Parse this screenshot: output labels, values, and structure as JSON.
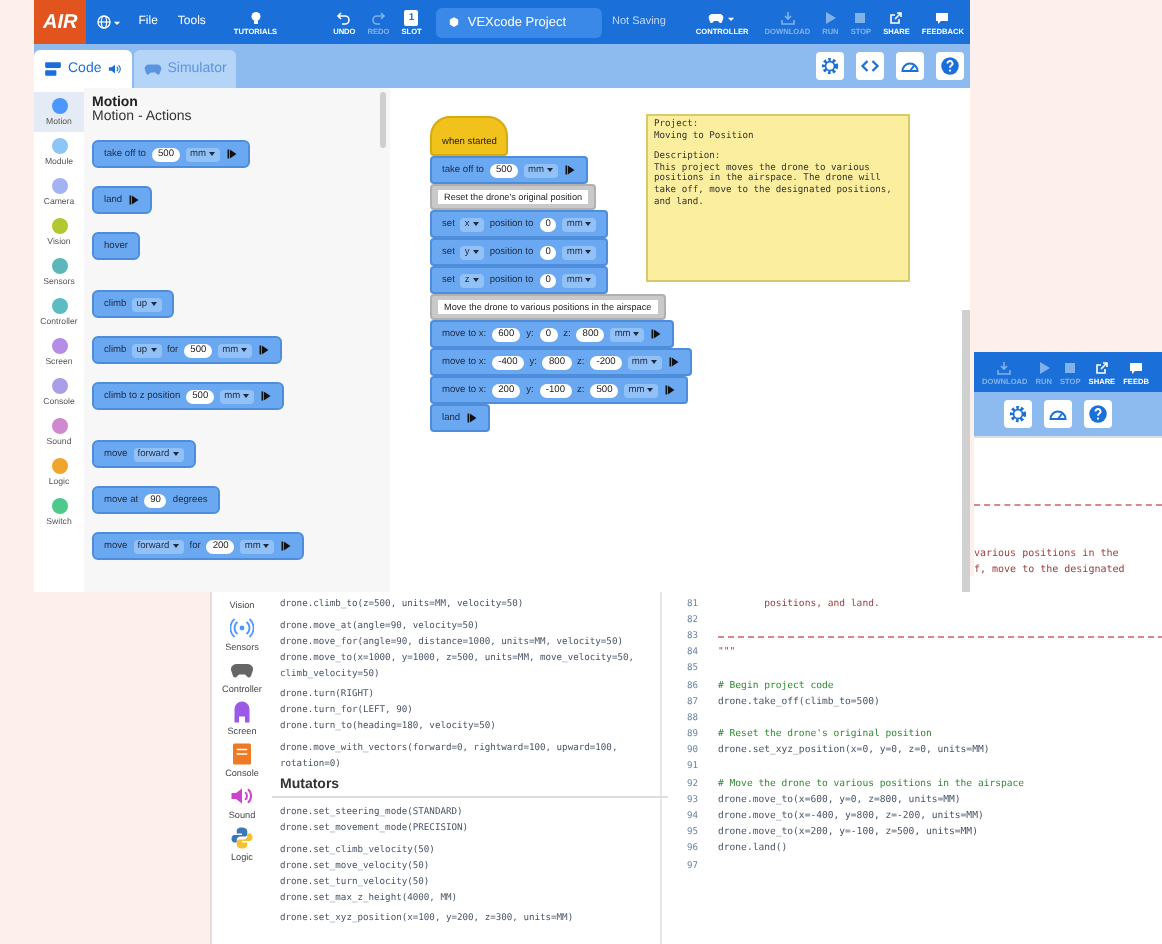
{
  "main_window": {
    "toolbar": {
      "logo": "AIR",
      "menus": [
        "File",
        "Tools"
      ],
      "tutorials": "TUTORIALS",
      "undo": {
        "label": "UNDO",
        "disabled": false
      },
      "redo": {
        "label": "REDO",
        "disabled": true
      },
      "slot": {
        "label": "SLOT",
        "number": "1"
      },
      "project_name": "VEXcode Project",
      "save_status": "Not Saving",
      "controller": "CONTROLLER",
      "actions": [
        {
          "kind": "download",
          "label": "DOWNLOAD",
          "disabled": true
        },
        {
          "kind": "run",
          "label": "RUN",
          "disabled": true
        },
        {
          "kind": "stop",
          "label": "STOP",
          "disabled": true
        },
        {
          "kind": "share",
          "label": "SHARE",
          "disabled": false
        },
        {
          "kind": "feedback",
          "label": "FEEDBACK",
          "disabled": false
        }
      ]
    },
    "tabs": [
      {
        "kind": "code",
        "label": "Code",
        "selected": true
      },
      {
        "kind": "simulator",
        "label": "Simulator",
        "selected": false
      }
    ],
    "tool_buttons": [
      {
        "kind": "settings"
      },
      {
        "kind": "code"
      },
      {
        "kind": "dashboard"
      },
      {
        "kind": "help"
      }
    ],
    "categories": [
      {
        "label": "Motion",
        "color": "#4c97ff",
        "selected": true
      },
      {
        "label": "Module",
        "color": "#8ec5f7",
        "selected": false
      },
      {
        "label": "Camera",
        "color": "#a3b3f2",
        "selected": false
      },
      {
        "label": "Vision",
        "color": "#b3c72e",
        "selected": false
      },
      {
        "label": "Sensors",
        "color": "#5cb8b8",
        "selected": false
      },
      {
        "label": "Controller",
        "color": "#5bbcc4",
        "selected": false
      },
      {
        "label": "Screen",
        "color": "#b58ce8",
        "selected": false
      },
      {
        "label": "Console",
        "color": "#a99fe9",
        "selected": false
      },
      {
        "label": "Sound",
        "color": "#cf89cf",
        "selected": false
      },
      {
        "label": "Logic",
        "color": "#f0a62c",
        "selected": false
      },
      {
        "label": "Switch",
        "color": "#4ec98c",
        "selected": false
      }
    ],
    "palette": {
      "title": "Motion",
      "subtitle": "Motion - Actions",
      "groups": [
        [
          {
            "parts": [
              {
                "kind": "text",
                "text": "take off to"
              },
              {
                "kind": "num",
                "text": "500"
              },
              {
                "kind": "drop",
                "text": "mm"
              },
              {
                "kind": "run"
              }
            ]
          },
          {
            "parts": [
              {
                "kind": "text",
                "text": "land"
              },
              {
                "kind": "run"
              }
            ]
          },
          {
            "parts": [
              {
                "kind": "text",
                "text": "hover"
              }
            ]
          }
        ],
        [
          {
            "parts": [
              {
                "kind": "text",
                "text": "climb"
              },
              {
                "kind": "drop",
                "text": "up"
              }
            ]
          },
          {
            "parts": [
              {
                "kind": "text",
                "text": "climb"
              },
              {
                "kind": "drop",
                "text": "up"
              },
              {
                "kind": "text",
                "text": "for"
              },
              {
                "kind": "num",
                "text": "500"
              },
              {
                "kind": "drop",
                "text": "mm"
              },
              {
                "kind": "run"
              }
            ]
          },
          {
            "parts": [
              {
                "kind": "text",
                "text": "climb to z position"
              },
              {
                "kind": "num",
                "text": "500"
              },
              {
                "kind": "drop",
                "text": "mm"
              },
              {
                "kind": "run"
              }
            ]
          }
        ],
        [
          {
            "parts": [
              {
                "kind": "text",
                "text": "move"
              },
              {
                "kind": "drop",
                "text": "forward"
              }
            ]
          },
          {
            "parts": [
              {
                "kind": "text",
                "text": "move at"
              },
              {
                "kind": "num",
                "text": "90"
              },
              {
                "kind": "text",
                "text": "degrees"
              }
            ]
          },
          {
            "parts": [
              {
                "kind": "text",
                "text": "move"
              },
              {
                "kind": "drop",
                "text": "forward"
              },
              {
                "kind": "text",
                "text": "for"
              },
              {
                "kind": "num",
                "text": "200"
              },
              {
                "kind": "drop",
                "text": "mm"
              },
              {
                "kind": "run"
              }
            ]
          }
        ]
      ]
    },
    "canvas": {
      "hat": "when started",
      "stack": [
        {
          "kind": "block",
          "parts": [
            {
              "kind": "text",
              "text": "take off to"
            },
            {
              "kind": "num",
              "text": "500"
            },
            {
              "kind": "drop",
              "text": "mm"
            },
            {
              "kind": "run"
            }
          ]
        },
        {
          "kind": "comment",
          "text": "Reset the drone's original position"
        },
        {
          "kind": "block",
          "parts": [
            {
              "kind": "text",
              "text": "set"
            },
            {
              "kind": "drop",
              "text": "x"
            },
            {
              "kind": "text",
              "text": "position to"
            },
            {
              "kind": "num",
              "text": "0"
            },
            {
              "kind": "drop",
              "text": "mm"
            }
          ]
        },
        {
          "kind": "block",
          "parts": [
            {
              "kind": "text",
              "text": "set"
            },
            {
              "kind": "drop",
              "text": "y"
            },
            {
              "kind": "text",
              "text": "position to"
            },
            {
              "kind": "num",
              "text": "0"
            },
            {
              "kind": "drop",
              "text": "mm"
            }
          ]
        },
        {
          "kind": "block",
          "parts": [
            {
              "kind": "text",
              "text": "set"
            },
            {
              "kind": "drop",
              "text": "z"
            },
            {
              "kind": "text",
              "text": "position to"
            },
            {
              "kind": "num",
              "text": "0"
            },
            {
              "kind": "drop",
              "text": "mm"
            }
          ]
        },
        {
          "kind": "comment",
          "text": "Move the drone to various positions in the airspace"
        },
        {
          "kind": "block",
          "parts": [
            {
              "kind": "text",
              "text": "move to x:"
            },
            {
              "kind": "num",
              "text": "600"
            },
            {
              "kind": "text",
              "text": "y:"
            },
            {
              "kind": "num",
              "text": "0"
            },
            {
              "kind": "text",
              "text": "z:"
            },
            {
              "kind": "num",
              "text": "800"
            },
            {
              "kind": "drop",
              "text": "mm"
            },
            {
              "kind": "run"
            }
          ]
        },
        {
          "kind": "block",
          "parts": [
            {
              "kind": "text",
              "text": "move to x:"
            },
            {
              "kind": "num",
              "text": "-400"
            },
            {
              "kind": "text",
              "text": "y:"
            },
            {
              "kind": "num",
              "text": "800"
            },
            {
              "kind": "text",
              "text": "z:"
            },
            {
              "kind": "num",
              "text": "-200"
            },
            {
              "kind": "drop",
              "text": "mm"
            },
            {
              "kind": "run"
            }
          ]
        },
        {
          "kind": "block",
          "parts": [
            {
              "kind": "text",
              "text": "move to x:"
            },
            {
              "kind": "num",
              "text": "200"
            },
            {
              "kind": "text",
              "text": "y:"
            },
            {
              "kind": "num",
              "text": "-100"
            },
            {
              "kind": "text",
              "text": "z:"
            },
            {
              "kind": "num",
              "text": "500"
            },
            {
              "kind": "drop",
              "text": "mm"
            },
            {
              "kind": "run"
            }
          ]
        },
        {
          "kind": "block",
          "parts": [
            {
              "kind": "text",
              "text": "land"
            },
            {
              "kind": "run"
            }
          ]
        }
      ],
      "note": {
        "paragraphs": [
          "Project:\nMoving to Position",
          "Description:\nThis project moves the drone to various\npositions in the airspace. The drone will\ntake off, move to the designated positions,\nand land."
        ]
      }
    }
  },
  "side_window": {
    "actions": [
      {
        "kind": "download",
        "label": "DOWNLOAD",
        "disabled": true
      },
      {
        "kind": "run",
        "label": "RUN",
        "disabled": true
      },
      {
        "kind": "stop",
        "label": "STOP",
        "disabled": true
      },
      {
        "kind": "share",
        "label": "SHARE",
        "disabled": false
      },
      {
        "kind": "feedback",
        "label": "FEEDB",
        "disabled": false
      }
    ],
    "tool_buttons": [
      {
        "kind": "settings"
      },
      {
        "kind": "dashboard"
      },
      {
        "kind": "help"
      }
    ],
    "lines": [
      {
        "kind": "rule"
      },
      {
        "kind": "doc",
        "text": "various positions in the"
      },
      {
        "kind": "doc",
        "text": "f, move to the designated"
      }
    ]
  },
  "bottom_window": {
    "categories": [
      {
        "kind": "vision",
        "label": "Vision"
      },
      {
        "kind": "sensors",
        "label": "Sensors"
      },
      {
        "kind": "controller",
        "label": "Controller"
      },
      {
        "kind": "screen",
        "label": "Screen"
      },
      {
        "kind": "console",
        "label": "Console"
      },
      {
        "kind": "sound",
        "label": "Sound"
      },
      {
        "kind": "logic",
        "label": "Logic"
      }
    ],
    "reference": [
      {
        "kind": "code",
        "lines": [
          "drone.climb_to(z=500, units=MM, velocity=50)"
        ]
      },
      {
        "kind": "code",
        "lines": [
          "drone.move_at(angle=90, velocity=50)",
          "drone.move_for(angle=90, distance=1000, units=MM, velocity=50)",
          "drone.move_to(x=1000, y=1000, z=500, units=MM, move_velocity=50,",
          "climb_velocity=50)"
        ]
      },
      {
        "kind": "code",
        "lines": [
          "drone.turn(RIGHT)",
          "drone.turn_for(LEFT, 90)",
          "drone.turn_to(heading=180, velocity=50)"
        ]
      },
      {
        "kind": "code",
        "lines": [
          "drone.move_with_vectors(forward=0, rightward=100, upward=100,",
          "rotation=0)"
        ]
      },
      {
        "kind": "heading",
        "text": "Mutators"
      },
      {
        "kind": "code",
        "lines": [
          "drone.set_steering_mode(STANDARD)",
          "drone.set_movement_mode(PRECISION)"
        ]
      },
      {
        "kind": "code",
        "lines": [
          "drone.set_climb_velocity(50)",
          "drone.set_move_velocity(50)",
          "drone.set_turn_velocity(50)",
          "drone.set_max_z_height(4000, MM)"
        ]
      },
      {
        "kind": "code",
        "lines": [
          "drone.set_xyz_position(x=100, y=200, z=300, units=MM)"
        ]
      }
    ],
    "editor": [
      {
        "number": "81",
        "kind": "doc",
        "text": "        positions, and land."
      },
      {
        "number": "82",
        "kind": "blank"
      },
      {
        "number": "83",
        "kind": "rule"
      },
      {
        "number": "84",
        "kind": "doc",
        "text": "\"\"\""
      },
      {
        "number": "85",
        "kind": "blank"
      },
      {
        "number": "86",
        "kind": "comment",
        "text": "# Begin project code"
      },
      {
        "number": "87",
        "kind": "code",
        "text": "drone.take_off(climb_to=500)"
      },
      {
        "number": "88",
        "kind": "blank"
      },
      {
        "number": "89",
        "kind": "comment",
        "text": "# Reset the drone's original position"
      },
      {
        "number": "90",
        "kind": "code",
        "text": "drone.set_xyz_position(x=0, y=0, z=0, units=MM)"
      },
      {
        "number": "91",
        "kind": "blank"
      },
      {
        "number": "92",
        "kind": "comment",
        "text": "# Move the drone to various positions in the airspace"
      },
      {
        "number": "93",
        "kind": "code",
        "text": "drone.move_to(x=600, y=0, z=800, units=MM)"
      },
      {
        "number": "94",
        "kind": "code",
        "text": "drone.move_to(x=-400, y=800, z=-200, units=MM)"
      },
      {
        "number": "95",
        "kind": "code",
        "text": "drone.move_to(x=200, y=-100, z=500, units=MM)"
      },
      {
        "number": "96",
        "kind": "code",
        "text": "drone.land()"
      },
      {
        "number": "97",
        "kind": "blank"
      }
    ]
  }
}
